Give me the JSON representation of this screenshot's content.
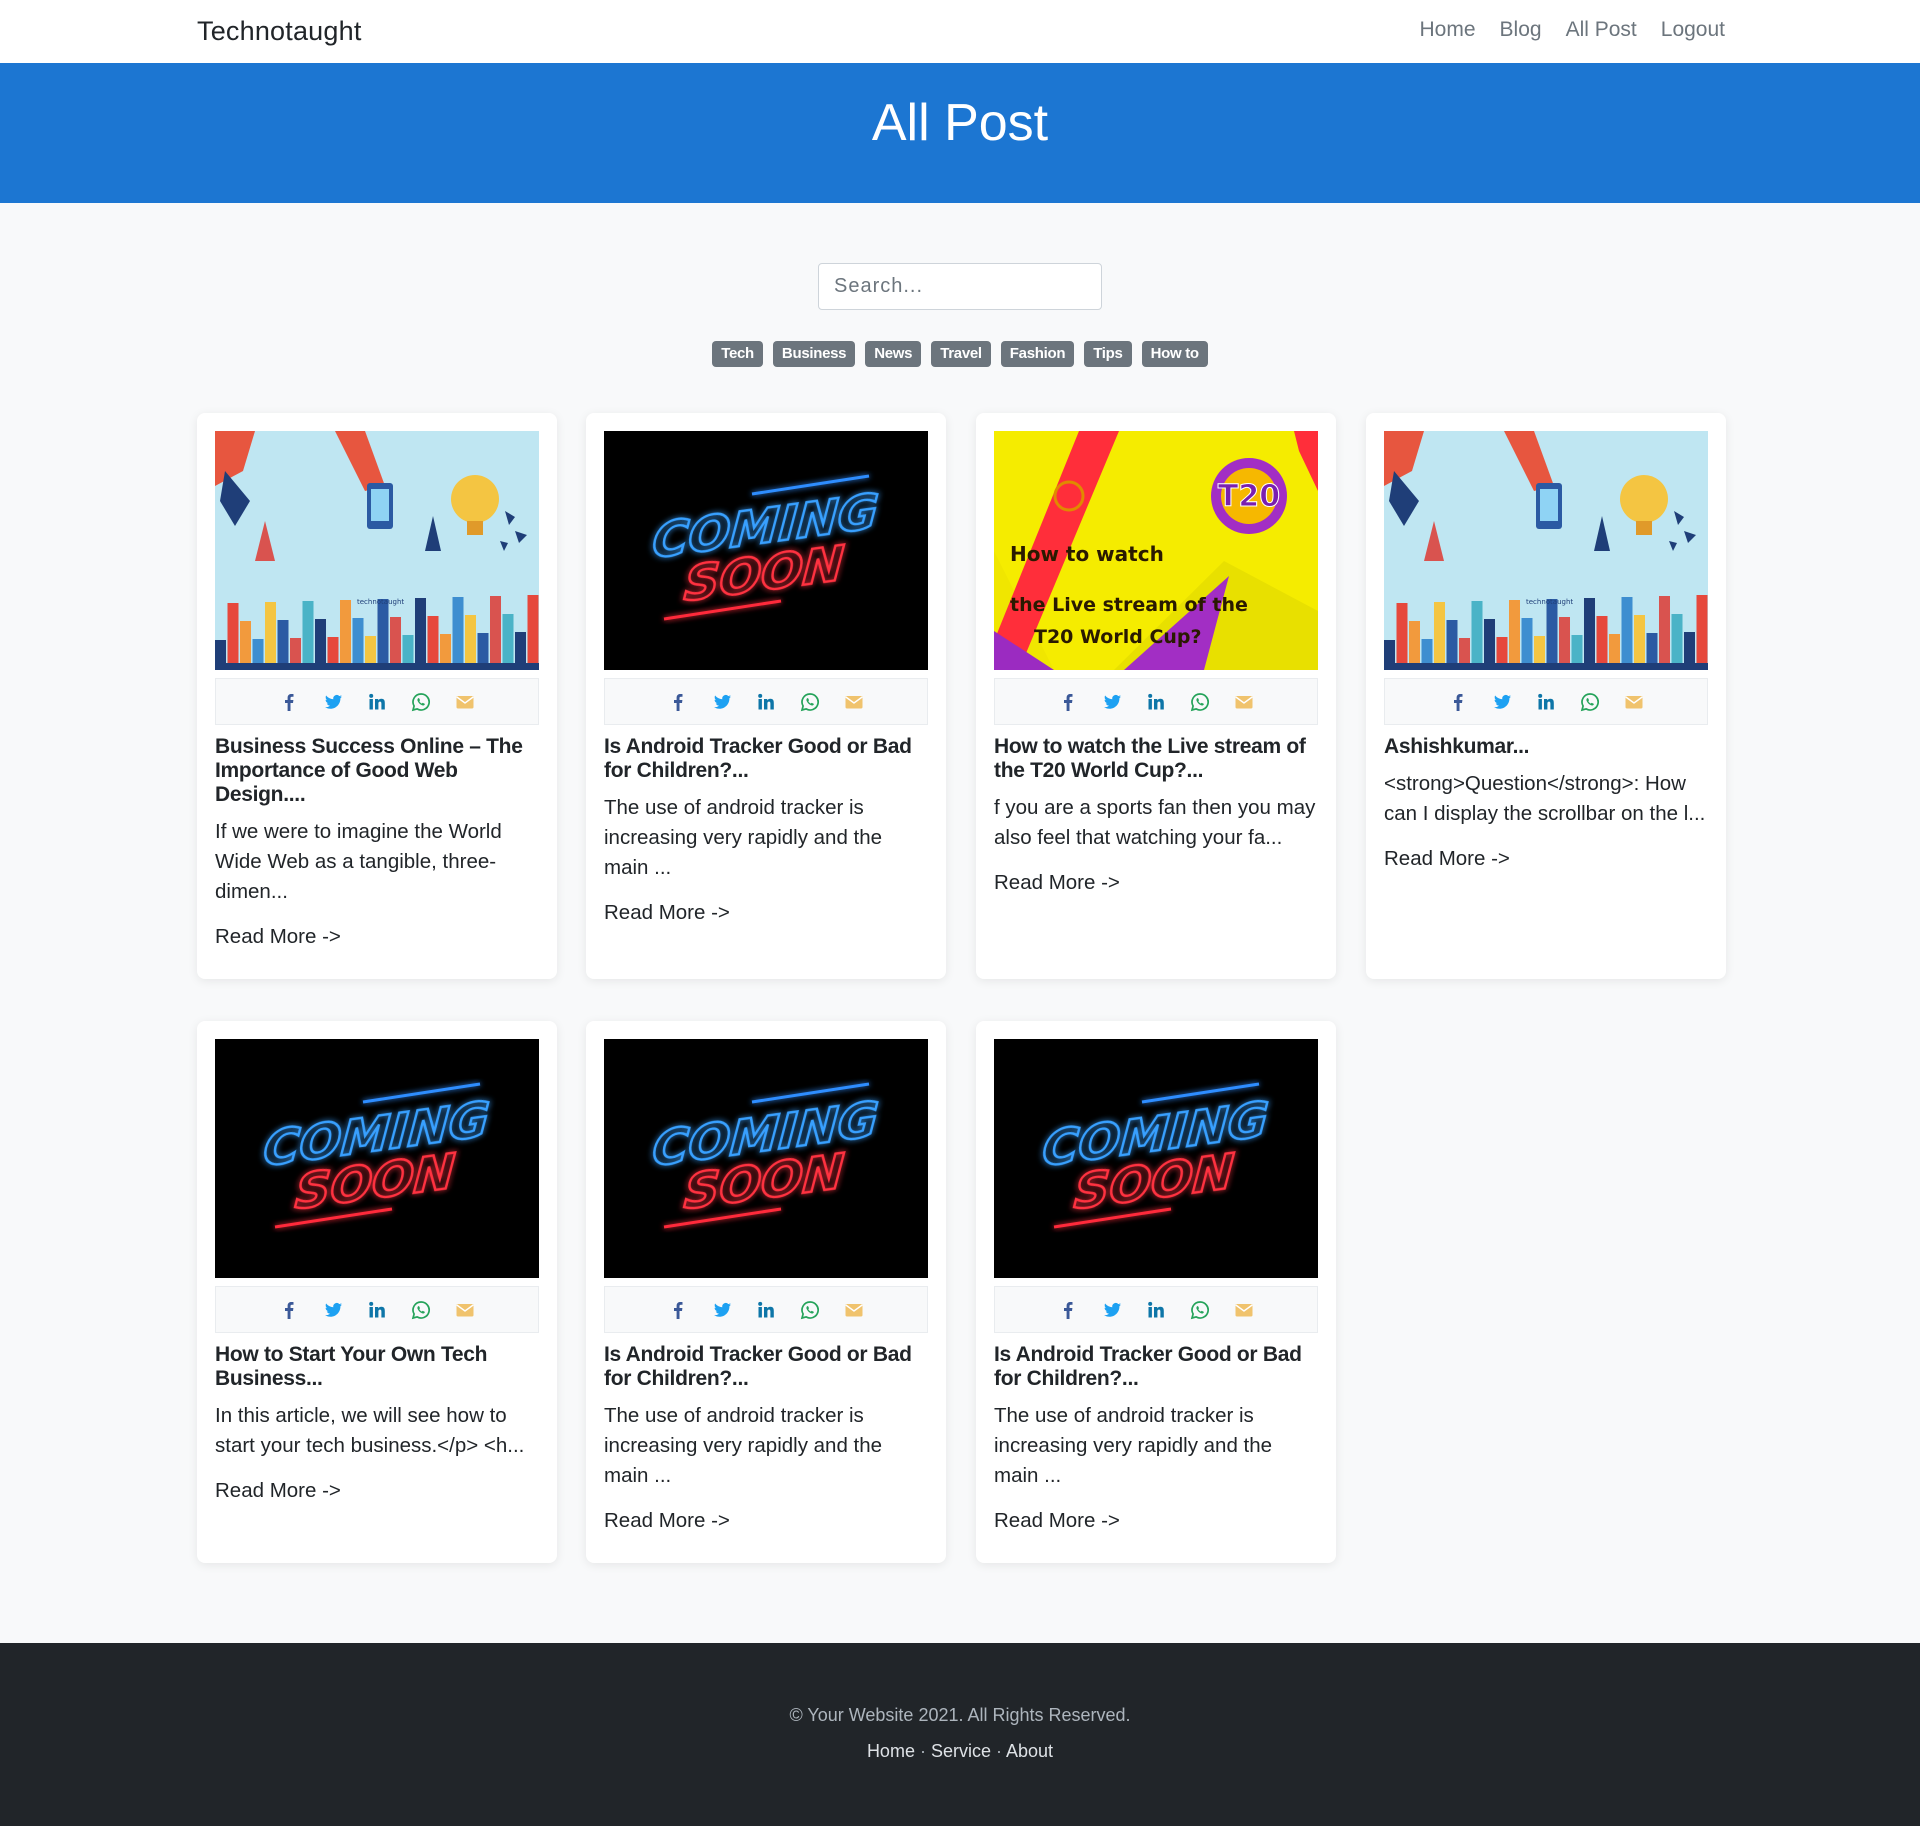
{
  "navbar": {
    "brand": "Technotaught",
    "links": [
      "Home",
      "Blog",
      "All Post",
      "Logout"
    ]
  },
  "hero": {
    "title": "All Post"
  },
  "search": {
    "placeholder": "Search..."
  },
  "tags": [
    "Tech",
    "Business",
    "News",
    "Travel",
    "Fashion",
    "Tips",
    "How to"
  ],
  "colors": {
    "primary": "#1c76d2",
    "tag": "#6c757d",
    "footer": "#212529",
    "facebook": "#3b5998",
    "twitter": "#1da1f2",
    "linkedin": "#0e76a8",
    "whatsapp": "#25a35a",
    "email": "#f0c36d"
  },
  "share_icons": [
    "facebook-icon",
    "twitter-icon",
    "linkedin-icon",
    "whatsapp-icon",
    "email-icon"
  ],
  "posts": [
    {
      "image": "business-illustration",
      "title": "Business Success Online – The Importance of Good Web Design....",
      "excerpt": "If we were to imagine the World Wide Web as a tangible, three-dimen...",
      "read_more": "Read More ->"
    },
    {
      "image": "coming-soon",
      "title": "Is Android Tracker Good or Bad for Children?...",
      "excerpt": "The use of android tracker is increasing very rapidly and the main ...",
      "read_more": "Read More ->"
    },
    {
      "image": "t20-world-cup",
      "title": "How to watch the Live stream of the T20 World Cup?...",
      "excerpt": "f you are a sports fan then you may also feel that watching your fa...",
      "read_more": "Read More ->"
    },
    {
      "image": "business-illustration",
      "title": "Ashishkumar...",
      "excerpt": "<strong>Question</strong>: How can I display the scrollbar on the l...",
      "read_more": "Read More ->"
    },
    {
      "image": "coming-soon",
      "title": "How to Start Your Own Tech Business...",
      "excerpt": "In this article, we will see how to start your tech business.</p> <h...",
      "read_more": "Read More ->"
    },
    {
      "image": "coming-soon",
      "title": "Is Android Tracker Good or Bad for Children?...",
      "excerpt": "The use of android tracker is increasing very rapidly and the main ...",
      "read_more": "Read More ->"
    },
    {
      "image": "coming-soon",
      "title": "Is Android Tracker Good or Bad for Children?...",
      "excerpt": "The use of android tracker is increasing very rapidly and the main ...",
      "read_more": "Read More ->"
    }
  ],
  "image_text": {
    "coming": "COMING",
    "soon": "SOON",
    "t20_line1": "How to watch",
    "t20_line2": "the Live stream of the",
    "t20_line3": "T20 World Cup?",
    "t20_badge": "T20",
    "watermark": "technotaught"
  },
  "footer": {
    "copyright": "© Your Website 2021. All Rights Reserved.",
    "links": [
      "Home",
      "Service",
      "About"
    ],
    "separator": " · "
  }
}
